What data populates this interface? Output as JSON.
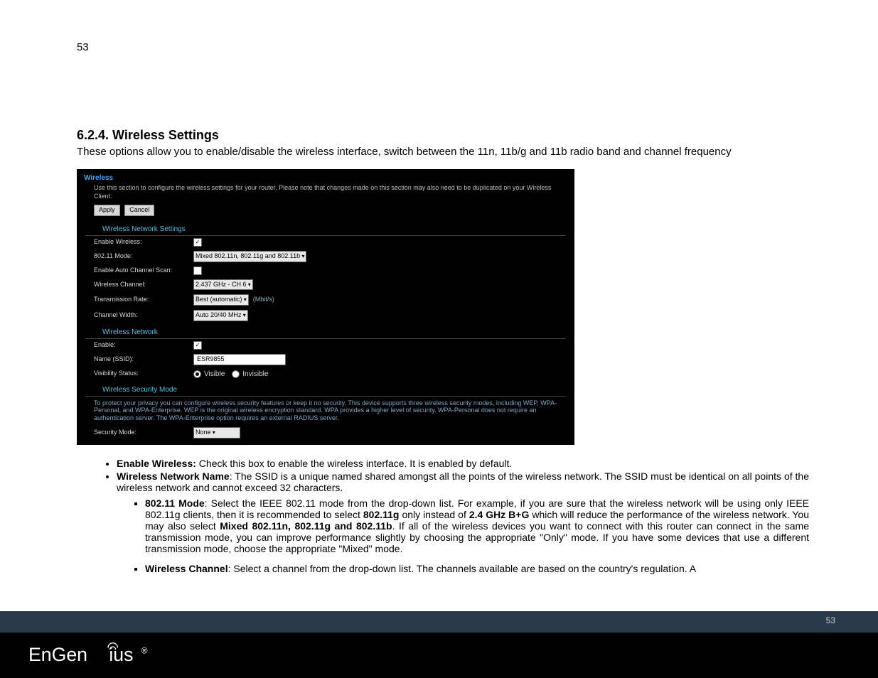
{
  "page_number_top": "53",
  "heading": "6.2.4. Wireless Settings",
  "intro": "These options allow you to enable/disable the wireless interface, switch between the 11n, 11b/g and 11b radio band and channel frequency",
  "screenshot": {
    "title": "Wireless",
    "note": "Use this section to configure the wireless settings for your router. Please note that changes made on this section may also need to be duplicated on your Wireless Client.",
    "apply": "Apply",
    "cancel": "Cancel",
    "section1": "Wireless Network Settings",
    "rows": {
      "enable_wireless_label": "Enable Wireless:",
      "mode_label": "802.11 Mode:",
      "mode_value": "Mixed 802.11n, 802.11g and 802.11b",
      "auto_scan_label": "Enable Auto Channel Scan:",
      "channel_label": "Wireless Channel:",
      "channel_value": "2.437 GHz - CH 6",
      "rate_label": "Transmission Rate:",
      "rate_value": "Best (automatic)",
      "rate_unit": "(Mbit/s)",
      "width_label": "Channel Width:",
      "width_value": "Auto 20/40 MHz"
    },
    "section2": "Wireless Network",
    "net": {
      "enable_label": "Enable:",
      "name_label": "Name (SSID):",
      "name_value": "ESR9855",
      "vis_label": "Visibility Status:",
      "vis_visible": "Visible",
      "vis_invisible": "Invisible"
    },
    "section3": "Wireless Security Mode",
    "sec_note": "To protect your privacy you can configure wireless security features or keep it no security. This device supports three wireless security modes, including WEP, WPA-Personal, and WPA-Enterprise. WEP is the original wireless encryption standard. WPA provides a higher level of security. WPA-Personal does not require an authentication server. The WPA-Enterprise option requires an external RADIUS server.",
    "sec_mode_label": "Security Mode:",
    "sec_mode_value": "None"
  },
  "bullets": {
    "b1_label": "Enable Wireless:",
    "b1_text": " Check this box to enable the wireless interface. It is enabled by default.",
    "b2_label": "Wireless Network Name",
    "b2_text": ": The SSID is a unique named shared amongst all the points of the wireless network. The SSID must be identical on all points of the wireless network and cannot exceed 32 characters.",
    "s1_label": "802.11 Mode",
    "s1_text_a": ": Select the IEEE 802.11 mode from the drop-down list. For example, if you are sure that the wireless network will be using only IEEE 802.11g clients, then it is recommended to select ",
    "s1_bold_a": "802.11g",
    "s1_text_b": " only instead of ",
    "s1_bold_b": "2.4 GHz B+G",
    "s1_text_c": " which will reduce the performance of the wireless network. You may also select ",
    "s1_bold_c": "Mixed 802.11n, 802.11g and 802.11b",
    "s1_text_d": ". If all of the wireless devices you want to connect with this router can connect in the same transmission mode, you can improve performance slightly by choosing the appropriate \"Only\" mode. If you have some devices that use a different transmission mode, choose the appropriate \"Mixed\" mode.",
    "s2_label": "Wireless Channel",
    "s2_text": ": Select a channel from the drop-down list. The channels available are based on the country's regulation. A"
  },
  "footer_page": "53",
  "brand": "EnGenius"
}
